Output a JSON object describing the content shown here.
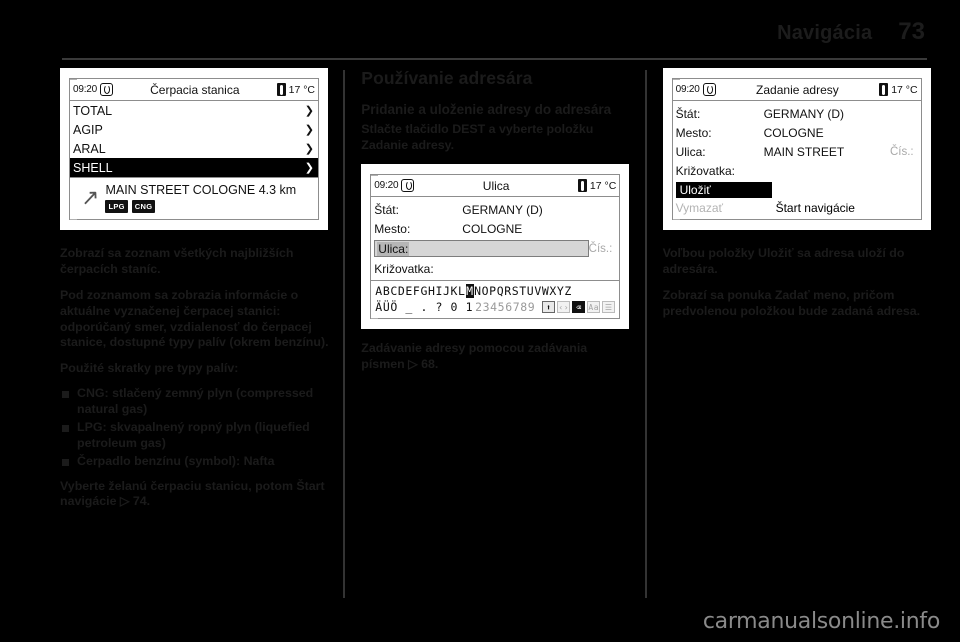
{
  "header": {
    "title": "Navigácia",
    "page_number": "73"
  },
  "footer": {
    "watermark": "carmanualsonline.info"
  },
  "left_column": {
    "screen": {
      "clock": "09:20",
      "title": "Čerpacia stanica",
      "temperature": "17 °C",
      "list": [
        {
          "label": "TOTAL",
          "selected": false
        },
        {
          "label": "AGIP",
          "selected": false
        },
        {
          "label": "ARAL",
          "selected": false
        },
        {
          "label": "SHELL",
          "selected": true
        }
      ],
      "detail": {
        "address": "MAIN STREET  COLOGNE 4.3  km",
        "tags": [
          "LPG",
          "CNG"
        ]
      }
    },
    "paragraphs": [
      "Zobrazí sa zoznam všetkých najbližších čerpacích staníc.",
      "Pod zoznamom sa zobrazia informácie o aktuálne vyznačenej čerpacej stanici: odporúčaný smer, vzdialenosť do čerpacej stanice, dostupné typy palív (okrem benzínu).",
      "Použité skratky pre typy palív:"
    ],
    "bullets": [
      "CNG: stlačený zemný plyn (compressed natural gas)",
      "LPG: skvapalnený ropný plyn (liquefied petroleum gas)",
      "Čerpadlo benzínu (symbol): Nafta"
    ],
    "closing": "Vyberte želanú čerpaciu stanicu, potom Štart navigácie ▷ 74."
  },
  "mid_column": {
    "heading": "Používanie adresára",
    "subheading": "Pridanie a uloženie adresy do adresára",
    "intro": "Stlačte tlačidlo DEST a vyberte položku Zadanie adresy.",
    "screen": {
      "clock": "09:20",
      "title": "Ulica",
      "temperature": "17 °C",
      "fields": [
        {
          "label": "Štát:",
          "value": "GERMANY (D)"
        },
        {
          "label": "Mesto:",
          "value": "COLOGNE"
        }
      ],
      "active_field": {
        "label": "Ulica:",
        "value": "",
        "suffix": "Čís.:"
      },
      "extra_field": {
        "label": "Križovatka:",
        "value": ""
      },
      "keyboard": {
        "row1_before": "ABCDEFGHIJKL",
        "row1_highlight": "M",
        "row1_after": "NOPQRSTUVWXYZ",
        "row2_letters": "ÄÜÖ _ . ? 0 1",
        "row2_grey": "23456789",
        "icons": [
          "shift-icon",
          "cursor-icon",
          "backspace-icon",
          "case-icon",
          "list-icon"
        ]
      }
    },
    "caption": "Zadávanie adresy pomocou zadávania písmen ▷ 68."
  },
  "right_column": {
    "screen": {
      "clock": "09:20",
      "title": "Zadanie adresy",
      "temperature": "17 °C",
      "fields": [
        {
          "label": "Štát:",
          "value": "GERMANY (D)"
        },
        {
          "label": "Mesto:",
          "value": "COLOGNE"
        },
        {
          "label": "Ulica:",
          "value": "MAIN STREET",
          "suffix": "Čís.:"
        },
        {
          "label": "Križovatka:",
          "value": ""
        }
      ],
      "selected_button": "Uložiť",
      "disabled_button": "Vymazať",
      "action_button": "Štart navigácie"
    },
    "paragraphs": [
      "Voľbou položky Uložiť sa adresa uloží do adresára.",
      "Zobrazí sa ponuka Zadať meno, pričom predvolenou položkou bude zadaná adresa."
    ]
  }
}
